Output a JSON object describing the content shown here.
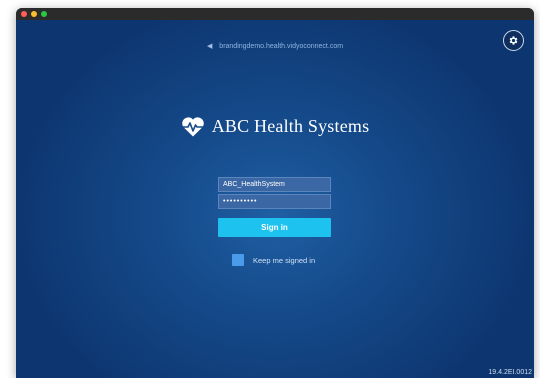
{
  "window": {
    "controls": [
      "close",
      "minimize",
      "zoom"
    ]
  },
  "header": {
    "domain": "brandingdemo.health.vidyoconnect.com",
    "back_icon": "chevron-left-icon",
    "settings_icon": "gear-icon"
  },
  "brand": {
    "logo_icon": "heart-pulse-icon",
    "name": "ABC Health Systems"
  },
  "login": {
    "username_value": "ABC_HealthSystem",
    "password_value": "••••••••••",
    "signin_label": "Sign in",
    "keep_signed_in_label": "Keep me signed in"
  },
  "footer": {
    "version": "19.4.2EI.0012"
  },
  "colors": {
    "background": "#154a8a",
    "signin_button": "#1ec2ef",
    "checkbox": "#4a9bea"
  }
}
